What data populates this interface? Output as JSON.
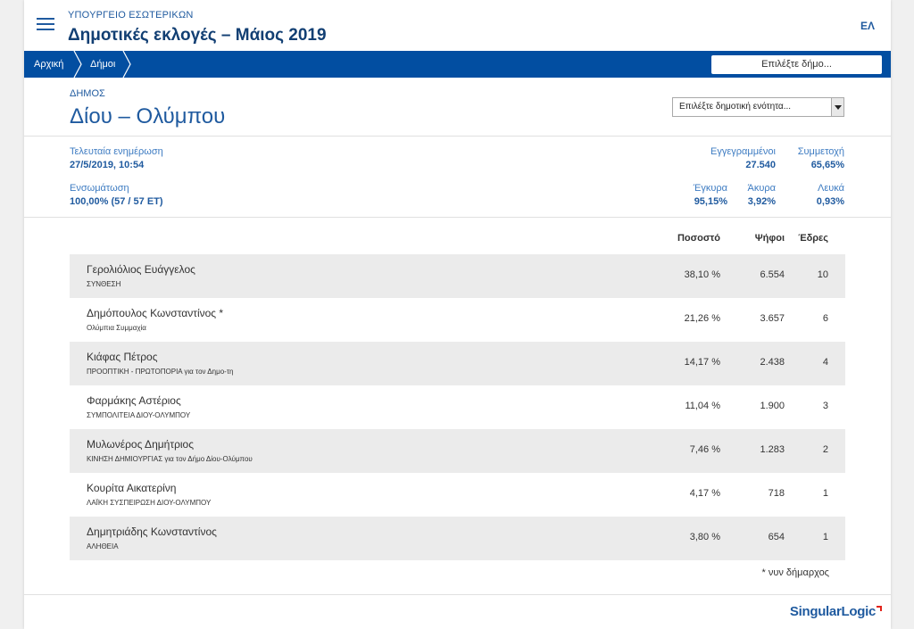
{
  "header": {
    "ministry": "ΥΠΟΥΡΓΕΙΟ ΕΣΩΤΕΡΙΚΩΝ",
    "title": "Δημοτικές εκλογές – Μάιος 2019",
    "language": "ΕΛ",
    "menu_icon": "hamburger-menu-icon"
  },
  "nav": {
    "breadcrumbs": [
      "Αρχική",
      "Δήμοι"
    ],
    "municipality_select_placeholder": "Επιλέξτε δήμο..."
  },
  "municipality": {
    "label": "ΔΗΜΟΣ",
    "name": "Δίου – Ολύμπου",
    "unit_select_placeholder": "Επιλέξτε δημοτική ενότητα..."
  },
  "stats": {
    "last_update_label": "Τελευταία ενημέρωση",
    "last_update_value": "27/5/2019, 10:54",
    "integration_label": "Ενσωμάτωση",
    "integration_value": "100,00% (57 / 57 ΕΤ)",
    "registered_label": "Εγγεγραμμένοι",
    "registered_value": "27.540",
    "turnout_label": "Συμμετοχή",
    "turnout_value": "65,65%",
    "valid_label": "Έγκυρα",
    "valid_value": "95,15%",
    "invalid_label": "Άκυρα",
    "invalid_value": "3,92%",
    "blank_label": "Λευκά",
    "blank_value": "0,93%"
  },
  "results": {
    "columns": [
      "Ποσοστό",
      "Ψήφοι",
      "Έδρες"
    ],
    "rows": [
      {
        "candidate": "Γερολιόλιος Ευάγγελος",
        "party": "ΣΥΝΘΕΣΗ",
        "percent": "38,10 %",
        "votes": "6.554",
        "seats": "10"
      },
      {
        "candidate": "Δημόπουλος Κωνσταντίνος *",
        "party": "Ολύμπια Συμμαχία",
        "percent": "21,26 %",
        "votes": "3.657",
        "seats": "6"
      },
      {
        "candidate": "Κιάφας Πέτρος",
        "party": "ΠΡΟΟΠΤΙΚΗ - ΠΡΩΤΟΠΟΡΙΑ για τον Δημο-τη",
        "percent": "14,17 %",
        "votes": "2.438",
        "seats": "4"
      },
      {
        "candidate": "Φαρμάκης Αστέριος",
        "party": "ΣΥΜΠΟΛΙΤΕΙΑ ΔΙΟΥ-ΟΛΥΜΠΟΥ",
        "percent": "11,04 %",
        "votes": "1.900",
        "seats": "3"
      },
      {
        "candidate": "Μυλωνέρος Δημήτριος",
        "party": "ΚΙΝΗΣΗ ΔΗΜΙΟΥΡΓΙΑΣ για τον Δήμο Δίου-Ολύμπου",
        "percent": "7,46 %",
        "votes": "1.283",
        "seats": "2"
      },
      {
        "candidate": "Κουρίτα Αικατερίνη",
        "party": "ΛΑΪΚΗ ΣΥΣΠΕΙΡΩΣΗ ΔΙΟΥ-ΟΛΥΜΠΟΥ",
        "percent": "4,17 %",
        "votes": "718",
        "seats": "1"
      },
      {
        "candidate": "Δημητριάδης Κωνσταντίνος",
        "party": "ΑΛΗΘΕΙΑ",
        "percent": "3,80 %",
        "votes": "654",
        "seats": "1"
      }
    ],
    "footnote": "* νυν δήμαρχος"
  },
  "footer": {
    "logo": "SingularLogic"
  },
  "colors": {
    "primary": "#024ea1",
    "title": "#123f73",
    "link": "#1f5a9f",
    "row_shade": "#ebebeb",
    "logo_accent": "#e2231a"
  }
}
